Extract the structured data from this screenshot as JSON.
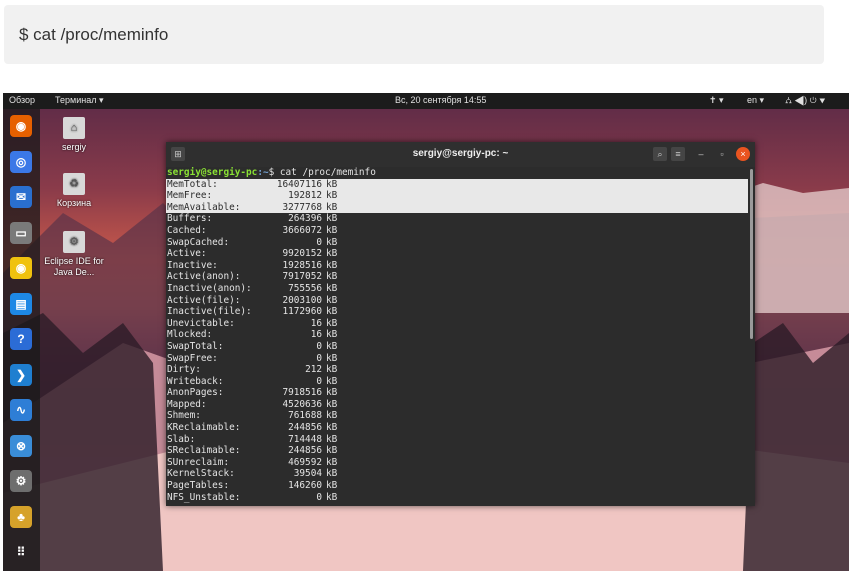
{
  "command_box": {
    "text": "$  cat /proc/meminfo"
  },
  "topbar": {
    "activities": "Обзор",
    "app_menu": "Терминал ▾",
    "clock": "Вс, 20 сентября  14:55",
    "lang": "en ▾",
    "accessibility": "✝ ▾",
    "system": "⛼ ◀) ⏻ ▾"
  },
  "desktop_icons": [
    {
      "label": "sergiy",
      "icon": "home-folder-icon"
    },
    {
      "label": "Корзина",
      "icon": "trash-icon"
    },
    {
      "label": "Eclipse IDE for Java De...",
      "icon": "eclipse-icon"
    }
  ],
  "terminal": {
    "title": "sergiy@sergiy-pc: ~",
    "prompt_user": "sergiy@sergiy-pc",
    "prompt_path": ":~",
    "prompt_cmd": "$ cat /proc/meminfo",
    "unit": "kB",
    "rows": [
      {
        "k": "MemTotal:",
        "v": "16407116",
        "sel": true
      },
      {
        "k": "MemFree:",
        "v": "192812",
        "sel": true
      },
      {
        "k": "MemAvailable:",
        "v": "3277768",
        "sel": true
      },
      {
        "k": "Buffers:",
        "v": "264396"
      },
      {
        "k": "Cached:",
        "v": "3666072"
      },
      {
        "k": "SwapCached:",
        "v": "0"
      },
      {
        "k": "Active:",
        "v": "9920152"
      },
      {
        "k": "Inactive:",
        "v": "1928516"
      },
      {
        "k": "Active(anon):",
        "v": "7917052"
      },
      {
        "k": "Inactive(anon):",
        "v": "755556"
      },
      {
        "k": "Active(file):",
        "v": "2003100"
      },
      {
        "k": "Inactive(file):",
        "v": "1172960"
      },
      {
        "k": "Unevictable:",
        "v": "16"
      },
      {
        "k": "Mlocked:",
        "v": "16"
      },
      {
        "k": "SwapTotal:",
        "v": "0"
      },
      {
        "k": "SwapFree:",
        "v": "0"
      },
      {
        "k": "Dirty:",
        "v": "212"
      },
      {
        "k": "Writeback:",
        "v": "0"
      },
      {
        "k": "AnonPages:",
        "v": "7918516"
      },
      {
        "k": "Mapped:",
        "v": "4520636"
      },
      {
        "k": "Shmem:",
        "v": "761688"
      },
      {
        "k": "KReclaimable:",
        "v": "244856"
      },
      {
        "k": "Slab:",
        "v": "714448"
      },
      {
        "k": "SReclaimable:",
        "v": "244856"
      },
      {
        "k": "SUnreclaim:",
        "v": "469592"
      },
      {
        "k": "KernelStack:",
        "v": "39504"
      },
      {
        "k": "PageTables:",
        "v": "146260"
      },
      {
        "k": "NFS_Unstable:",
        "v": "0"
      }
    ]
  },
  "dock": [
    {
      "name": "firefox-icon",
      "glyph": "◉",
      "color": "#e66000"
    },
    {
      "name": "chromium-icon",
      "glyph": "◎",
      "color": "#3b78e7"
    },
    {
      "name": "thunderbird-icon",
      "glyph": "✉",
      "color": "#2a6fcf"
    },
    {
      "name": "files-icon",
      "glyph": "▭",
      "color": "#7a7a7a"
    },
    {
      "name": "rhythmbox-icon",
      "glyph": "◉",
      "color": "#f0c20e"
    },
    {
      "name": "writer-icon",
      "glyph": "▤",
      "color": "#1e88e5"
    },
    {
      "name": "help-icon",
      "glyph": "?",
      "color": "#2b6cd6"
    },
    {
      "name": "vscode-icon",
      "glyph": "❯",
      "color": "#1f7fd0"
    },
    {
      "name": "system-monitor-icon",
      "glyph": "∿",
      "color": "#2e7ed6"
    },
    {
      "name": "software-updater-icon",
      "glyph": "⊗",
      "color": "#3a8dd8"
    },
    {
      "name": "settings-icon",
      "glyph": "⚙",
      "color": "#6e6e6e"
    },
    {
      "name": "games-icon",
      "glyph": "♣",
      "color": "#d6a22a"
    },
    {
      "name": "show-apps-icon",
      "glyph": "⠿",
      "color": "transparent"
    }
  ]
}
